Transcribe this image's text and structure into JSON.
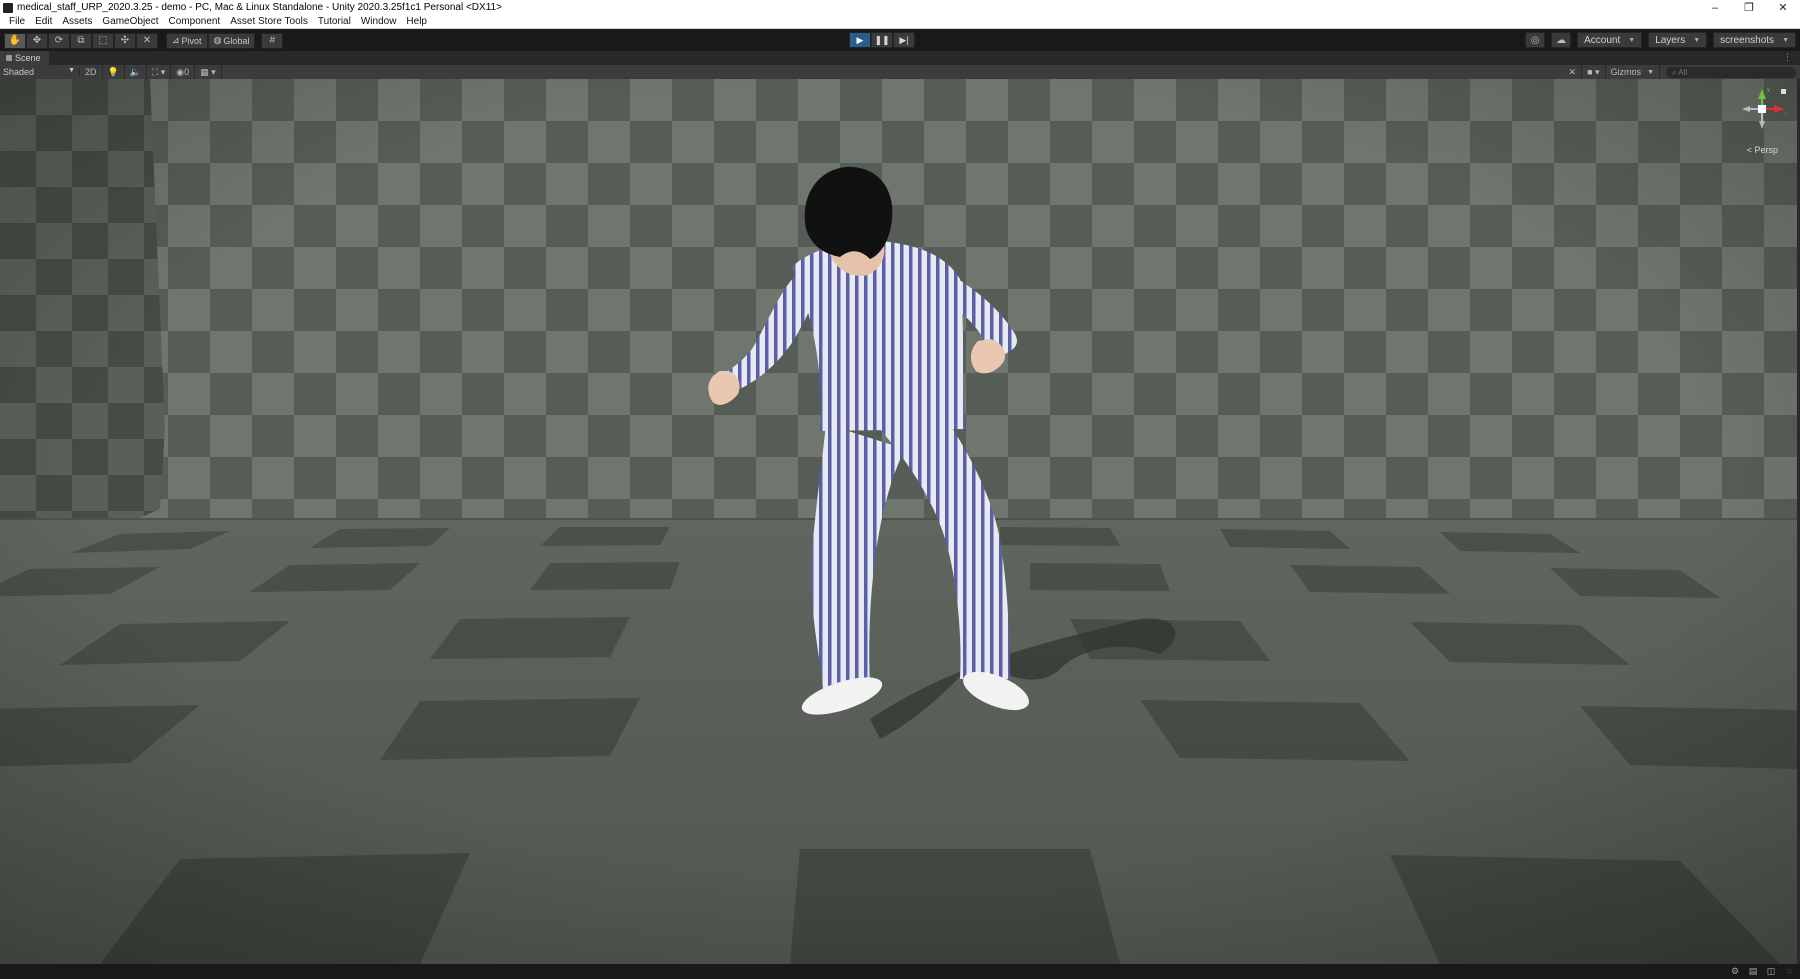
{
  "window": {
    "title": "medical_staff_URP_2020.3.25 - demo - PC, Mac & Linux Standalone - Unity 2020.3.25f1c1 Personal <DX11>",
    "controls": [
      "–",
      "❐",
      "✕"
    ]
  },
  "menu": [
    "File",
    "Edit",
    "Assets",
    "GameObject",
    "Component",
    "Asset Store Tools",
    "Tutorial",
    "Window",
    "Help"
  ],
  "toolbar": {
    "tools": [
      "hand-tool",
      "move-tool",
      "rotate-tool",
      "scale-tool",
      "rect-tool",
      "transform-tool",
      "custom-tool"
    ],
    "pivot_label": "Pivot",
    "global_label": "Global",
    "account_label": "Account",
    "layers_label": "Layers",
    "layout_label": "screenshots",
    "play_state": "playing"
  },
  "scene_tab": {
    "label": "Scene"
  },
  "scene_toolbar": {
    "draw_mode": "Shaded",
    "mode_2d": "2D",
    "hidden_count": "0",
    "gizmos_label": "Gizmos",
    "search_placeholder": "All"
  },
  "gizmo": {
    "y_label": "y",
    "x_label": "x",
    "projection": "< Persp"
  },
  "colors": {
    "play_active": "#2b5c8c",
    "gizmo_y": "#6fc23b",
    "gizmo_x": "#e0302a",
    "pajama_stripe": "#5a60a8",
    "pajama_base": "#e8e9f2"
  }
}
